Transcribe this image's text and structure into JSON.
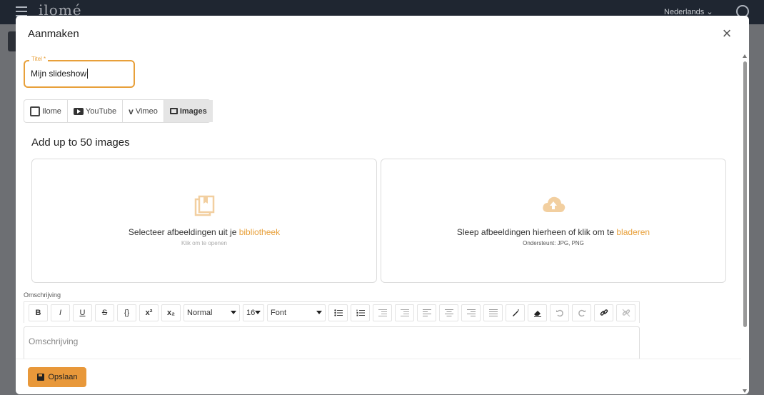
{
  "appbar": {
    "logo": "ilomé",
    "language": "Nederlands ⌄"
  },
  "modal": {
    "title": "Aanmaken",
    "close": "×"
  },
  "title_field": {
    "label": "Titel *",
    "value": "Mijn slideshow"
  },
  "tabs": [
    {
      "label": "Ilome",
      "icon": "ilome-icon"
    },
    {
      "label": "YouTube",
      "icon": "youtube-icon"
    },
    {
      "label": "Vimeo",
      "icon": "vimeo-icon"
    },
    {
      "label": "Images",
      "icon": "images-icon",
      "active": true
    }
  ],
  "images_section": {
    "heading": "Add up to 50 images",
    "library": {
      "text": "Selecteer afbeeldingen uit je ",
      "link": "bibliotheek",
      "sub": "Klik om te openen"
    },
    "upload": {
      "text": "Sleep afbeeldingen hierheen of klik om te ",
      "link": "bladeren",
      "sub": "Ondersteunt: JPG, PNG"
    }
  },
  "description": {
    "label": "Omschrijving",
    "placeholder": "Omschrijving",
    "toolbar": {
      "bold": "B",
      "italic": "I",
      "underline": "U",
      "strike": "S",
      "code": "{}",
      "superscript": "x²",
      "subscript": "x₂",
      "heading_select": "Normal",
      "size_select": "16",
      "font_select": "Font"
    }
  },
  "footer": {
    "save_label": "Opslaan"
  },
  "colors": {
    "accent": "#e8a03a",
    "button": "#e8983a",
    "appbar": "#1f2631"
  }
}
